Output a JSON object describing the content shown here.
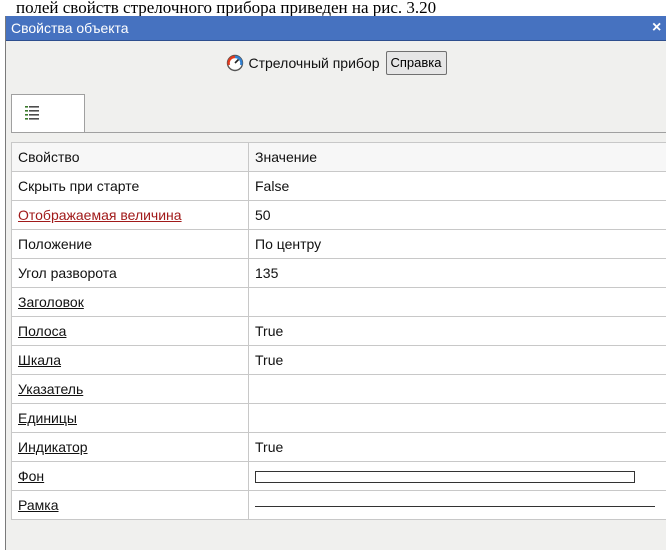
{
  "caption": "полей свойств стрелочного прибора приведен на рис. 3.20",
  "window": {
    "title": "Свойства объекта",
    "close_glyph": "×"
  },
  "toolbar": {
    "object_label": "Стрелочный прибор",
    "help_label": "Справка",
    "icon": "gauge-icon"
  },
  "tabs": [
    {
      "icon": "property-list-icon",
      "selected": true
    }
  ],
  "grid": {
    "headers": [
      "Свойство",
      "Значение"
    ],
    "rows": [
      {
        "prop": "Скрыть при старте",
        "value": "False"
      },
      {
        "prop": "Отображаемая величина",
        "value": "50"
      },
      {
        "prop": "Положение",
        "value": "По центру"
      },
      {
        "prop": "Угол разворота",
        "value": "135"
      },
      {
        "prop": "Заголовок",
        "value": ""
      },
      {
        "prop": "Полоса",
        "value": "True"
      },
      {
        "prop": "Шкала",
        "value": "True"
      },
      {
        "prop": "Указатель",
        "value": ""
      },
      {
        "prop": "Единицы",
        "value": ""
      },
      {
        "prop": "Индикатор",
        "value": "True"
      },
      {
        "prop": "Фон",
        "value": ""
      },
      {
        "prop": "Рамка",
        "value": ""
      }
    ]
  }
}
